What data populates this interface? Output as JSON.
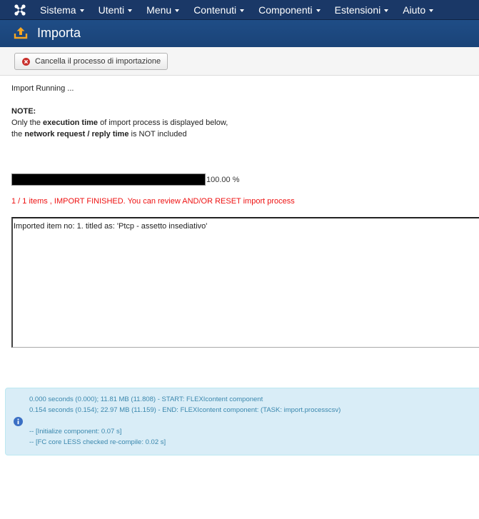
{
  "navbar": {
    "logo_icon": "joomla-icon",
    "items": [
      {
        "label": "Sistema"
      },
      {
        "label": "Utenti"
      },
      {
        "label": "Menu"
      },
      {
        "label": "Contenuti"
      },
      {
        "label": "Componenti"
      },
      {
        "label": "Estensioni"
      },
      {
        "label": "Aiuto"
      }
    ]
  },
  "subhead": {
    "icon": "upload-icon",
    "title": "Importa"
  },
  "toolbar": {
    "cancel_icon": "cancel-circle-icon",
    "cancel_label": "Cancella il processo di importazione"
  },
  "content": {
    "running_text": "Import Running ...",
    "note_heading": "NOTE:",
    "note_line1_prefix": "Only the ",
    "note_line1_bold": "execution time",
    "note_line1_suffix": " of import process is displayed below,",
    "note_line2_prefix": "the ",
    "note_line2_bold": "network request / reply time",
    "note_line2_suffix": " is NOT included",
    "progress_percent": 100,
    "progress_text": "100.00 %",
    "finished_message": "1 / 1 items , IMPORT FINISHED. You can review AND/OR RESET import process",
    "log_text": "Imported item no: 1. titled as: 'Ptcp - assetto insediativo'"
  },
  "debug": {
    "icon": "info-icon",
    "colors": {
      "background": "#d9edf7",
      "text": "#3a87ad"
    },
    "lines": [
      "0.000 seconds (0.000); 11.81 MB (11.808) - START: FLEXIcontent component",
      "0.154 seconds (0.154); 22.97 MB (11.159) - END: FLEXIcontent component: (TASK: import.processcsv)",
      "",
      "-- [Initialize component: 0.07 s]",
      "-- [FC core LESS checked re-compile: 0.02 s]"
    ]
  }
}
